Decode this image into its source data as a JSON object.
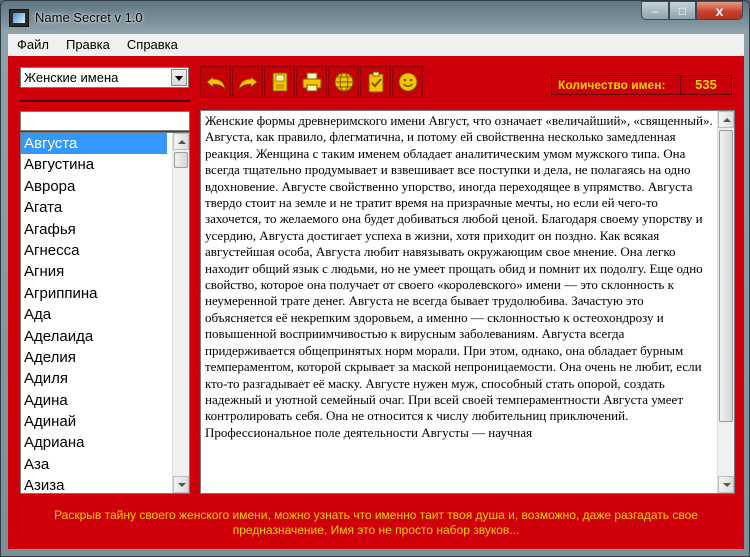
{
  "window": {
    "title": "Name Secret v 1.0",
    "caption_min": "–",
    "caption_max": "□",
    "caption_close": "x"
  },
  "menu": [
    "Файл",
    "Правка",
    "Справка"
  ],
  "category": {
    "selected": "Женские имена"
  },
  "toolbar": [
    {
      "icon": "undo-icon"
    },
    {
      "icon": "redo-icon"
    },
    {
      "icon": "save-icon"
    },
    {
      "icon": "print-icon"
    },
    {
      "icon": "globe-icon"
    },
    {
      "icon": "clipboard-check-icon"
    },
    {
      "icon": "smiley-icon"
    }
  ],
  "counter": {
    "label": "Количество имен:",
    "value": "535"
  },
  "search": {
    "value": ""
  },
  "names": [
    "Августа",
    "Августина",
    "Аврора",
    "Агата",
    "Агафья",
    "Агнесса",
    "Агния",
    "Агриппина",
    "Ада",
    "Аделаида",
    "Аделия",
    "Адиля",
    "Адина",
    "Адинай",
    "Адриана",
    "Аза",
    "Азиза"
  ],
  "selected_name": "Августа",
  "description": "Женские формы древнеримского имени Август, что означает «величайший», «священный».  Августа, как правило, флегматична, и потому ей свойственна несколько замедленная реакция. Женщина с таким именем обладает аналитическим умом мужского типа. Она всегда тщательно продумывает и взвешивает все поступки и дела, не полагаясь на одно вдохновение. Августе свойственно упорство, иногда переходящее в упрямство.  Августа твердо стоит на земле и не тратит время на призрачные мечты, но если ей чего-то захочется, то желаемого она будет добиваться любой ценой. Благодаря своему упорству и усердию, Августа достигает успеха в жизни, хотя приходит он поздно.  Как всякая августейшая особа, Августа любит навязывать окружающим свое мнение. Она легко находит общий язык с людьми, но не умеет прощать обид и помнит их подолгу. Еще одно свойство, которое она получает от своего «королевского» имени — это склонность к неумеренной трате денег.  Августа не всегда бывает трудолюбива. Зачастую это объясняется её некрепким здоровьем, а именно — склонностью к остеохондрозу и повышенной восприимчивостью к вирусным заболеваниям.  Августа всегда придерживается общепринятых норм морали. При этом, однако, она обладает бурным темпераментом, которой скрывает за маской непроницаемости. Она очень не любит, если кто-то разгадывает её маску. Августе нужен муж, способный стать опорой, создать надежный и уютной семейный очаг. При всей своей темпераментности Августа умеет контролировать себя. Она не относится к числу любительниц приключений.  Профессиональное поле деятельности Августы — научная",
  "footer": "Раскрыв тайну своего женского имени, можно узнать что именно таит твоя душа и, возможно, даже разгадать свое предназначение. Имя это не просто набор звуков...",
  "colors": {
    "client_bg": "#d0000b",
    "accent_text": "#f5d400",
    "selection": "#3399ff"
  }
}
